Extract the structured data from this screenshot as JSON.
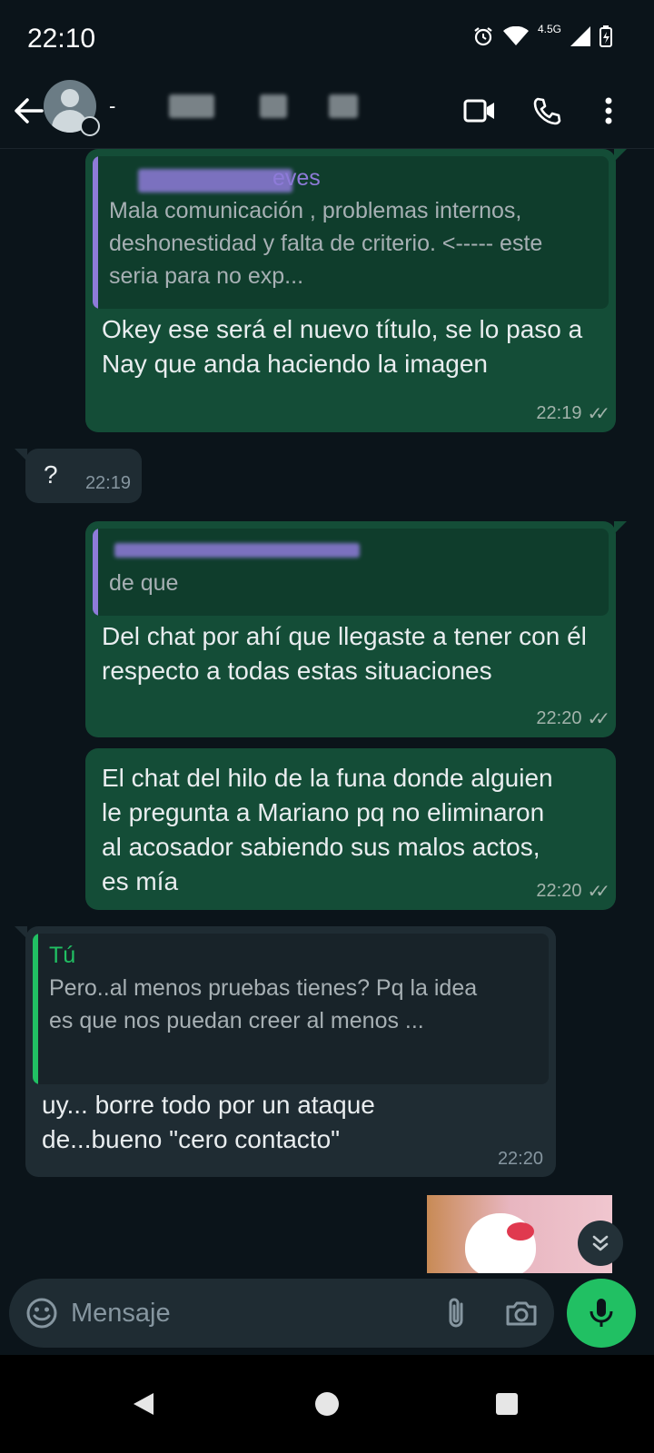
{
  "status_bar": {
    "time": "22:10",
    "network": "4.5G"
  },
  "header": {
    "contact_name": "-"
  },
  "messages": [
    {
      "quote_author": "eves",
      "quote_text": "Mala comunicación , problemas internos, deshonestidad y falta de criterio. <----- este seria para no exp...",
      "text": "Okey ese será el nuevo título, se lo paso a Nay que anda haciendo la imagen",
      "time": "22:19"
    },
    {
      "text": "?",
      "time": "22:19"
    },
    {
      "quote_author": "",
      "quote_text": "de que",
      "text": "Del chat por ahí que llegaste a tener con él respecto a todas estas situaciones",
      "time": "22:20"
    },
    {
      "text": "El chat del hilo de la funa donde alguien le pregunta a Mariano pq no eliminaron al acosador sabiendo sus malos actos, es mía",
      "time": "22:20"
    },
    {
      "quote_author": "Tú",
      "quote_text": "Pero..al menos pruebas tienes? Pq la idea es que nos puedan creer al menos ...",
      "text": "uy... borre todo por un ataque de...bueno \"cero contacto\"",
      "time": "22:20"
    }
  ],
  "composer": {
    "placeholder": "Mensaje"
  },
  "colors": {
    "background": "#0b141a",
    "outgoing_bubble": "#144d37",
    "incoming_bubble": "#1f2c33",
    "accent": "#21c063",
    "quote_bar": "#8e7bd9"
  }
}
